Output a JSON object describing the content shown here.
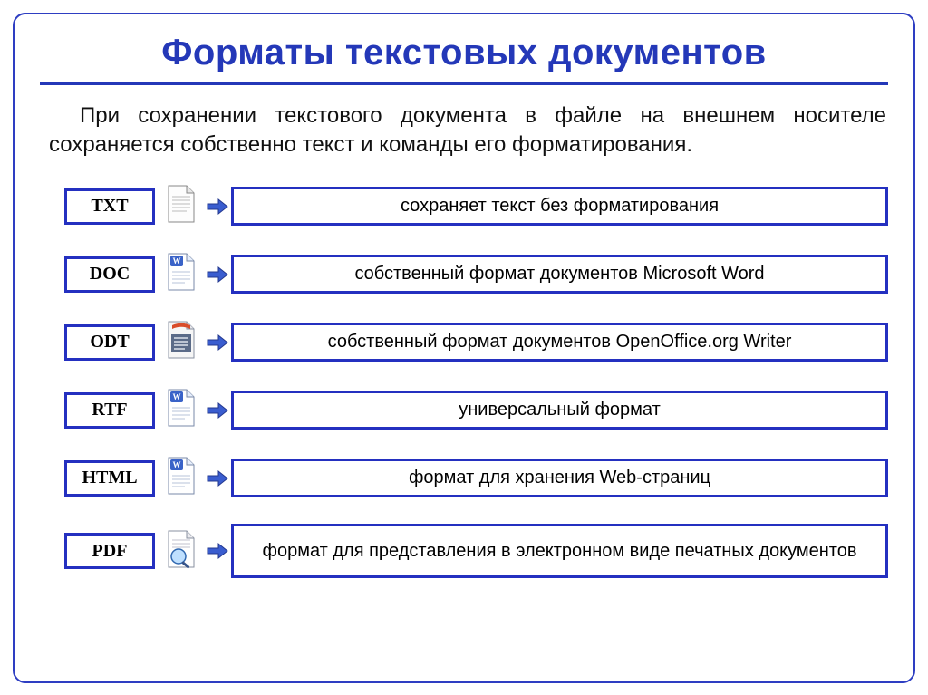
{
  "title": "Форматы текстовых документов",
  "lead": "При сохранении текстового документа в файле на внешнем носителе сохраняется собственно текст и команды его форматирования.",
  "formats": [
    {
      "code": "TXT",
      "icon": "txt",
      "desc": "сохраняет текст без форматирования"
    },
    {
      "code": "DOC",
      "icon": "doc",
      "desc": "собственный формат документов Microsoft Word"
    },
    {
      "code": "ODT",
      "icon": "odt",
      "desc": "собственный формат документов OpenOffice.org Writer"
    },
    {
      "code": "RTF",
      "icon": "doc",
      "desc": "универсальный формат"
    },
    {
      "code": "HTML",
      "icon": "doc",
      "desc": "формат для хранения Web-страниц"
    },
    {
      "code": "PDF",
      "icon": "pdf",
      "desc": "формат для представления в электронном виде печатных документов"
    }
  ],
  "colors": {
    "border": "#2430c0",
    "title": "#2438b8",
    "arrow": "#3a5dcf"
  }
}
